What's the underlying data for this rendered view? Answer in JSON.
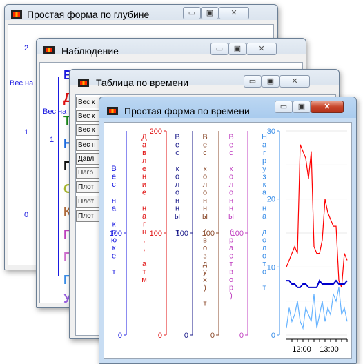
{
  "windows": [
    {
      "id": "depth_form",
      "title": "Простая форма по глубине",
      "ticks": [
        "2",
        "1",
        "0"
      ],
      "axis_label": "Вес на крюке т"
    },
    {
      "id": "observation",
      "title": "Наблюдение",
      "ticks": [
        "1"
      ],
      "axis_label": "Вес на крюке т",
      "legend_letters": [
        "В",
        "Д",
        "Т",
        "Н",
        "Г",
        "О",
        "К",
        "П",
        "П",
        "П",
        "У"
      ]
    },
    {
      "id": "time_table",
      "title": "Таблица по времени",
      "rows": [
        "Вес к",
        "Вес к",
        "Вес к",
        "Вес н",
        "Давл",
        "Нагр",
        "Плот",
        "Плот",
        "Плот"
      ]
    },
    {
      "id": "time_form",
      "title": "Простая форма по времени"
    }
  ],
  "window_controls": {
    "minimize": "▭",
    "maximize": "▣",
    "close": "✕"
  },
  "chart_data": {
    "type": "line",
    "axes": [
      {
        "name": "Вес на крюке т",
        "color": "#1a1ae0",
        "ylim": [
          0,
          200
        ],
        "ticks": [
          "100",
          "0"
        ]
      },
      {
        "name": "Давление нагн., атм",
        "color": "#e01010",
        "ylim": [
          0,
          200
        ],
        "ticks": [
          "200",
          "100",
          "0"
        ]
      },
      {
        "name": "Вес колонны т",
        "color": "#1a1a8a",
        "ylim": [
          0,
          200
        ],
        "ticks": [
          "100",
          "0"
        ]
      },
      {
        "name": "Вес колонны (воздух) т",
        "color": "#8b4a2b",
        "ylim": [
          0,
          200
        ],
        "ticks": [
          "100",
          "0"
        ]
      },
      {
        "name": "Вес колонны (раствор)",
        "color": "#c040c0",
        "ylim": [
          0,
          200
        ],
        "ticks": [
          "100",
          "0"
        ]
      },
      {
        "name": "Нагрузка на долото т",
        "color": "#3a8ee8",
        "ylim": [
          0,
          30
        ],
        "ticks": [
          "30",
          "20",
          "10",
          "0"
        ]
      }
    ],
    "x_ticks": [
      "12:00",
      "13:00"
    ],
    "series": [
      {
        "color": "#ff0000",
        "values": [
          10,
          11,
          12,
          13,
          12,
          28,
          27,
          26,
          23,
          27,
          13,
          12,
          12,
          14,
          20,
          18,
          17,
          16,
          16,
          8,
          7,
          12,
          11
        ]
      },
      {
        "color": "#0000cc",
        "values": [
          8,
          8,
          7.5,
          7.5,
          7,
          7,
          7.5,
          7.5,
          7,
          7,
          7,
          7,
          8,
          7.5,
          7.5,
          7.5,
          7.5,
          7.5,
          8,
          7.5,
          7.5,
          7.5,
          8
        ]
      },
      {
        "color": "#66b3ff",
        "values": [
          1,
          4,
          2,
          3,
          5,
          2,
          1,
          4,
          3,
          2,
          6,
          1,
          3,
          5,
          2,
          4,
          3,
          6,
          5,
          7,
          3,
          4,
          2
        ]
      }
    ]
  }
}
